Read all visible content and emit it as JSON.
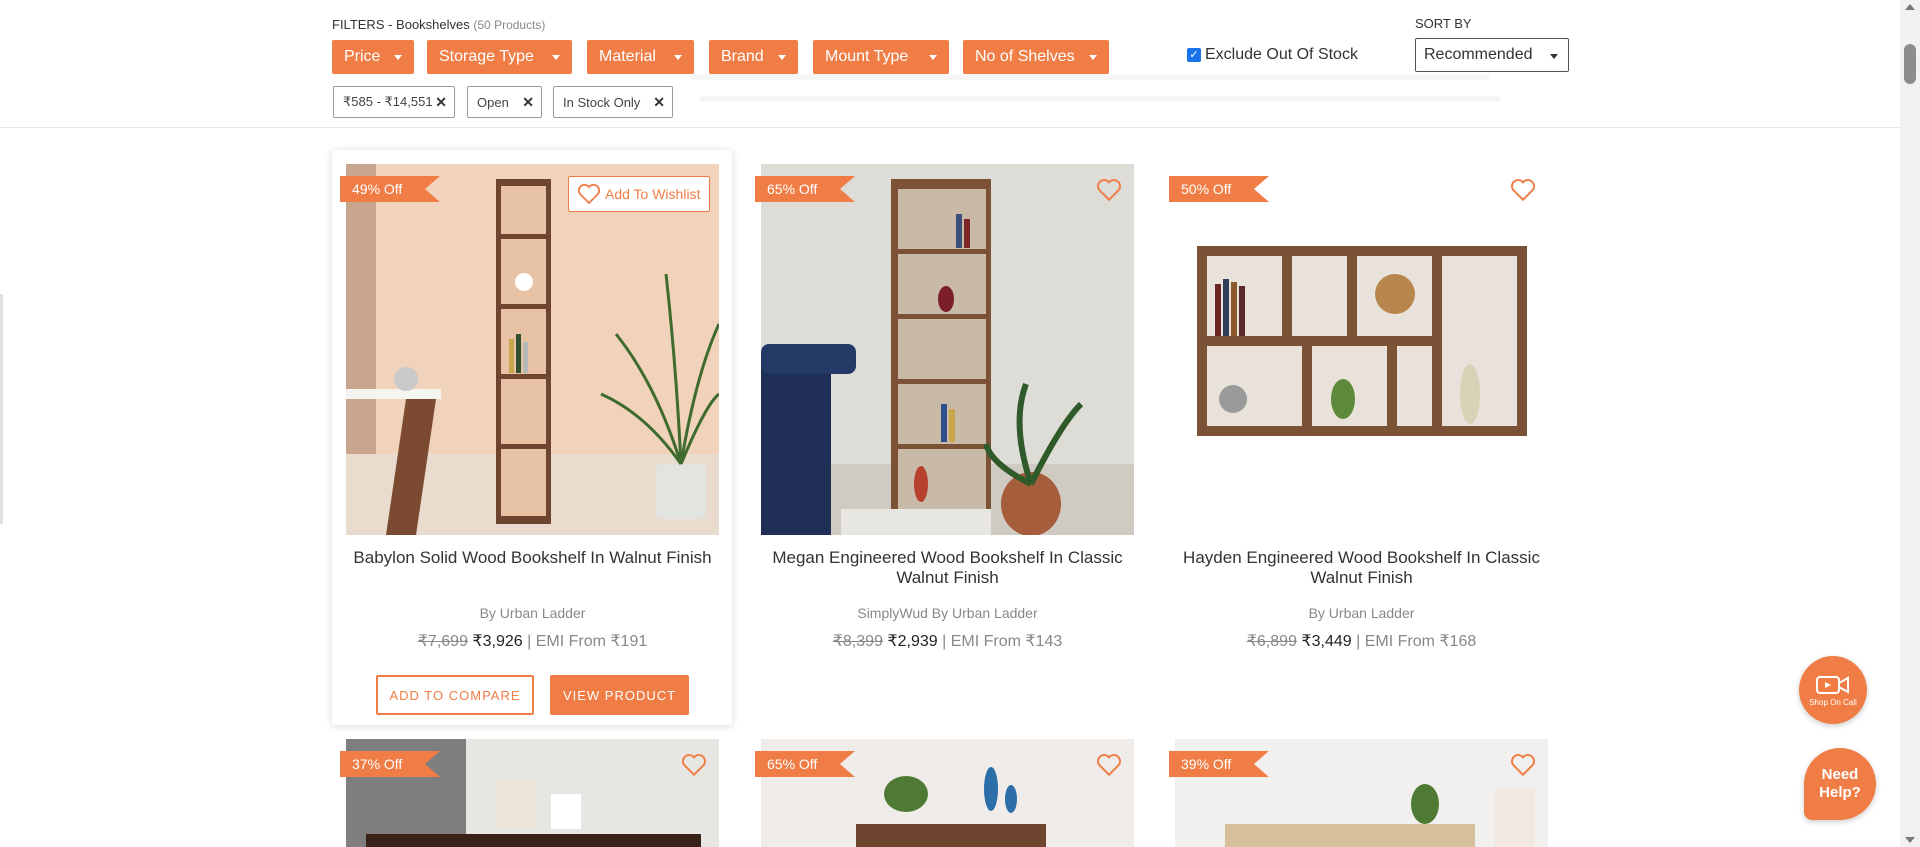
{
  "filters": {
    "heading": "FILTERS - Bookshelves",
    "count": "(50 Products)",
    "buttons": [
      "Price",
      "Storage Type",
      "Material",
      "Brand",
      "Mount Type",
      "No of Shelves"
    ],
    "exclude_label": "Exclude Out Of Stock",
    "exclude_checked": true,
    "applied": [
      "₹585 - ₹14,551",
      "Open",
      "In Stock Only"
    ],
    "remove_icon": "close-icon"
  },
  "sort": {
    "label": "SORT BY",
    "value": "Recommended"
  },
  "colors": {
    "accent": "#f07d46",
    "text": "#333333",
    "muted": "#888888"
  },
  "products": [
    {
      "discount": "49% Off",
      "name": "Babylon Solid Wood Bookshelf In Walnut Finish",
      "brand": "By Urban Ladder",
      "mrp": "₹7,699",
      "price": "₹3,926",
      "emi": "| EMI From ₹191",
      "wishlist_label": "Add To Wishlist",
      "compare_label": "ADD TO COMPARE",
      "view_label": "VIEW PRODUCT"
    },
    {
      "discount": "65% Off",
      "name": "Megan Engineered Wood Bookshelf In Classic Walnut Finish",
      "brand": "SimplyWud By Urban Ladder",
      "mrp": "₹8,399",
      "price": "₹2,939",
      "emi": "| EMI From ₹143"
    },
    {
      "discount": "50% Off",
      "name": "Hayden Engineered Wood Bookshelf In Classic Walnut Finish",
      "brand": "By Urban Ladder",
      "mrp": "₹6,899",
      "price": "₹3,449",
      "emi": "| EMI From ₹168"
    },
    {
      "discount": "37% Off"
    },
    {
      "discount": "65% Off"
    },
    {
      "discount": "39% Off"
    }
  ],
  "floating": {
    "call_label": "Shop On Call",
    "help_label": "Need Help?"
  }
}
